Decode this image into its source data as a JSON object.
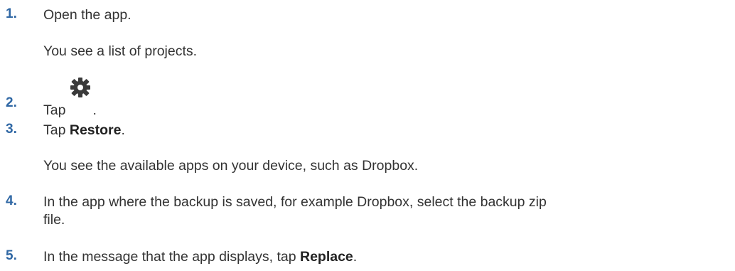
{
  "steps": [
    {
      "number": "1.",
      "text": "Open the app."
    },
    {
      "note": "You see a list of projects."
    },
    {
      "number": "2.",
      "text_before": "Tap",
      "icon": "gear-icon",
      "text_after": "."
    },
    {
      "number": "3.",
      "text_before": "Tap ",
      "bold": "Restore",
      "text_after": "."
    },
    {
      "note": "You see the available apps on your device, such as Dropbox."
    },
    {
      "number": "4.",
      "text_line1": "In the app where the backup is saved, for example Dropbox, select the backup zip",
      "text_line2": "file."
    },
    {
      "number": "5.",
      "text_before": "In the message that the app displays, tap ",
      "bold": "Replace",
      "text_after": "."
    }
  ],
  "colors": {
    "step_number": "#2f67a4",
    "text": "#333333"
  }
}
